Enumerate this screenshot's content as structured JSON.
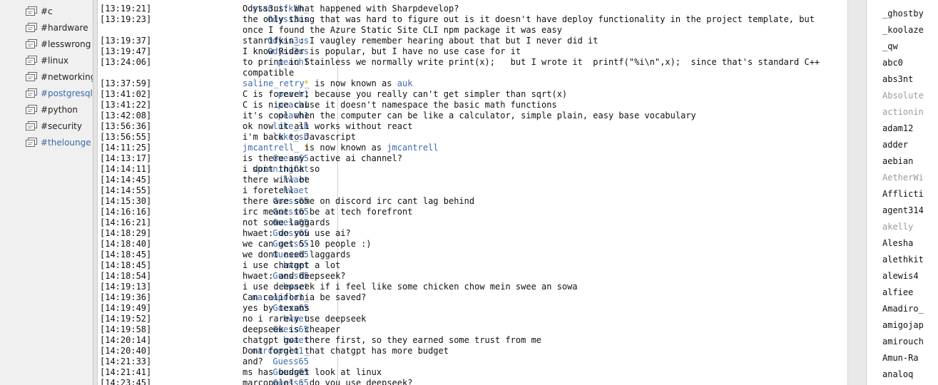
{
  "channels": [
    {
      "name": "#c",
      "highlight": false
    },
    {
      "name": "#hardware",
      "highlight": false
    },
    {
      "name": "#lesswrong",
      "highlight": false
    },
    {
      "name": "#linux",
      "highlight": false
    },
    {
      "name": "#networking",
      "highlight": false
    },
    {
      "name": "#postgresql",
      "highlight": true
    },
    {
      "name": "#python",
      "highlight": false
    },
    {
      "name": "#security",
      "highlight": false
    },
    {
      "name": "#thelounge",
      "highlight": true
    }
  ],
  "messages": [
    {
      "time": "[13:19:21]",
      "nick": "stanrifkin_",
      "text": "Odyss3us: What happened with Sharpdevelop?"
    },
    {
      "time": "[13:19:23]",
      "nick": "Odyss3us",
      "text": "the only thing that was hard to figure out is it doesn't have deploy functionality in the project template, but once I found the Azure Static Site CLI npm package it was easy"
    },
    {
      "time": "[13:19:37]",
      "nick": "Odyss3us",
      "text": "stanrifkin_: I vaugley remember hearing about that but I never did it"
    },
    {
      "time": "[13:19:47]",
      "nick": "Odyss3us",
      "text": "I know Rider is popular, but I have no use case for it"
    },
    {
      "time": "[13:24:06]",
      "nick": "peach1",
      "text": "to print in Stainless we normally write print(x);   but I wrote it  printf(\"%i\\n\",x);  since that's standard C++ compatible"
    },
    {
      "time": "[13:37:59]",
      "nick": "*",
      "system": true,
      "old": "saline_retry_",
      "mid": " is now known as ",
      "new": "auk"
    },
    {
      "time": "[13:41:02]",
      "nick": "peach1",
      "text": "C is forever; because you really can't get simpler than sqrt(x)"
    },
    {
      "time": "[13:41:22]",
      "nick": "peach1",
      "text": "C is nice cause it doesn't namespace the basic math functions"
    },
    {
      "time": "[13:42:08]",
      "nick": "peach1",
      "text": "it's cool when the computer can be like a calculator, simple plain, easy base vocabulary"
    },
    {
      "time": "[13:56:36]",
      "nick": "luke_sb",
      "text": "ok now it all works without react"
    },
    {
      "time": "[13:56:55]",
      "nick": "luke_sb",
      "text": "i'm back to Javascript"
    },
    {
      "time": "[14:11:25]",
      "nick": "*",
      "system": true,
      "old": "jmcantrell_",
      "mid": " is now known as ",
      "new": "jmcantrell"
    },
    {
      "time": "[14:13:17]",
      "nick": "Guess65",
      "text": "is there any active ai channel?"
    },
    {
      "time": "[14:14:11]",
      "nick": "spinningCat",
      "text": "i dont think so"
    },
    {
      "time": "[14:14:45]",
      "nick": "hwaet",
      "text": "there will be"
    },
    {
      "time": "[14:14:55]",
      "nick": "hwaet",
      "text": "i foretell"
    },
    {
      "time": "[14:15:30]",
      "nick": "Guess65",
      "text": "there are some on discord irc cant lag behind"
    },
    {
      "time": "[14:16:16]",
      "nick": "Guess65",
      "text": "irc meant to be at tech forefront"
    },
    {
      "time": "[14:16:21]",
      "nick": "Guess65",
      "text": "not some laggards"
    },
    {
      "time": "[14:18:29]",
      "nick": "Guess65",
      "text": "hwaet: do you use ai?"
    },
    {
      "time": "[14:18:40]",
      "nick": "Guess65",
      "text": "we can get 5-10 people :)"
    },
    {
      "time": "[14:18:45]",
      "nick": "Guess65",
      "text": "we dont need laggards"
    },
    {
      "time": "[14:18:45]",
      "nick": "hwaet",
      "text": "i use chatgpt a lot"
    },
    {
      "time": "[14:18:54]",
      "nick": "Guess65",
      "text": "hwaet: and deepseek?"
    },
    {
      "time": "[14:19:13]",
      "nick": "hwaet",
      "text": "i use deepseek if i feel like some chicken chow mein swee an sowa"
    },
    {
      "time": "[14:19:36]",
      "nick": "marcopolo1_",
      "text": "Can california be saved?"
    },
    {
      "time": "[14:19:49]",
      "nick": "Guess65",
      "text": "yes by texans"
    },
    {
      "time": "[14:19:52]",
      "nick": "hwaet",
      "text": "no i rarely use deepseek"
    },
    {
      "time": "[14:19:58]",
      "nick": "Guess65",
      "text": "deepseek is cheaper"
    },
    {
      "time": "[14:20:14]",
      "nick": "hwaet",
      "text": "chatgpt got there first, so they earned some trust from me"
    },
    {
      "time": "[14:20:40]",
      "nick": "marcopolo1_",
      "text": "Dont forget that chatgpt has more budget"
    },
    {
      "time": "[14:21:33]",
      "nick": "Guess65",
      "text": "and?"
    },
    {
      "time": "[14:21:41]",
      "nick": "Guess65",
      "text": "ms has budget look at linux"
    },
    {
      "time": "[14:23:45]",
      "nick": "Guess65",
      "text": "marcopolo1_: do you use deepseek?"
    }
  ],
  "users": [
    {
      "name": "_ghostby",
      "away": false
    },
    {
      "name": "_koolaze",
      "away": false
    },
    {
      "name": "_qw",
      "away": false
    },
    {
      "name": "abc0",
      "away": false
    },
    {
      "name": "abs3nt",
      "away": false
    },
    {
      "name": "Absolute",
      "away": true
    },
    {
      "name": "actionin",
      "away": true
    },
    {
      "name": "adam12",
      "away": false
    },
    {
      "name": "adder",
      "away": false
    },
    {
      "name": "aebian",
      "away": false
    },
    {
      "name": "AetherWi",
      "away": true
    },
    {
      "name": "Afflicti",
      "away": false
    },
    {
      "name": "agent314",
      "away": false
    },
    {
      "name": "akelly",
      "away": true
    },
    {
      "name": "Alesha",
      "away": false
    },
    {
      "name": "alethkit",
      "away": false
    },
    {
      "name": "alewis4",
      "away": false
    },
    {
      "name": "alfiee",
      "away": false
    },
    {
      "name": "Amadiro_",
      "away": false
    },
    {
      "name": "amigojap",
      "away": false
    },
    {
      "name": "amirouch",
      "away": false
    },
    {
      "name": "Amun-Ra",
      "away": false
    },
    {
      "name": "analoq",
      "away": false
    }
  ],
  "colors": {
    "nick": "#3b6aa8",
    "star": "#d4b000",
    "away": "#9a9a9a"
  }
}
